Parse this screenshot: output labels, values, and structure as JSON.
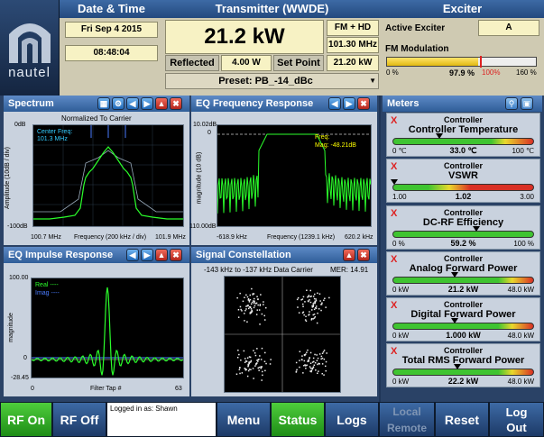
{
  "brand": "nautel",
  "date_time": {
    "title": "Date & Time",
    "date": "Fri Sep 4 2015",
    "time": "08:48:04"
  },
  "transmitter": {
    "title": "Transmitter (WWDE)",
    "power": "21.2 kW",
    "mode": "FM + HD",
    "frequency": "101.30 MHz",
    "reflected_label": "Reflected",
    "reflected_value": "4.00 W",
    "setpoint_label": "Set Point",
    "setpoint_value": "21.20 kW",
    "preset": "Preset: PB_-14_dBc"
  },
  "exciter": {
    "title": "Exciter",
    "active_label": "Active Exciter",
    "active_value": "A",
    "mod_label": "FM Modulation",
    "mod_fraction": 0.979,
    "mod_lo": "0 %",
    "mod_value": "97.9 %",
    "mod_mark": "100%",
    "mod_hi": "160 %"
  },
  "spectrum": {
    "title": "Spectrum",
    "subtitle": "Normalized To Carrier",
    "center": "Center Freq:",
    "center_value": "101.3 MHz",
    "y_top": "0dB",
    "y_bottom": "-100dB",
    "ylabel": "Amplitude (10dB / div)",
    "x_left": "100.7 MHz",
    "x_mid": "Frequency (200 kHz / div)",
    "x_right": "101.9 MHz"
  },
  "eq_freq": {
    "title": "EQ Frequency Response",
    "y_top": "10.02dB",
    "y_zero": "0",
    "y_bottom": "110.00dB",
    "ylabel": "magnitude (10 dB)",
    "freq_label": "Freq:",
    "mag_label": "Mag: -48.21dB",
    "x_left": "-618.9 kHz",
    "x_mid": "Frequency (1239.1 kHz)",
    "x_right": "620.2 kHz"
  },
  "eq_impulse": {
    "title": "EQ Impulse Response",
    "y_top": "100.00",
    "y_zero": "0",
    "y_bottom": "-28.45",
    "ylabel": "magnitude",
    "legend_real": "Real ----",
    "legend_imag": "Imag ----",
    "x_left": "0",
    "x_mid": "Filter Tap #",
    "x_right": "63"
  },
  "constellation": {
    "title": "Signal Constellation",
    "subtitle": "-143 kHz to -137 kHz Data Carrier",
    "mer": "MER: 14.91"
  },
  "meters": {
    "title": "Meters",
    "items": [
      {
        "l1": "Controller",
        "l2": "Controller Temperature",
        "lo": "0 ℃",
        "val": "33.0 ℃",
        "hi": "100 ℃",
        "fraction": 0.33
      },
      {
        "l1": "Controller",
        "l2": "VSWR",
        "lo": "1.00",
        "val": "1.02",
        "hi": "3.00",
        "fraction": 0.01
      },
      {
        "l1": "Controller",
        "l2": "DC-RF Efficiency",
        "lo": "0 %",
        "val": "59.2 %",
        "hi": "100 %",
        "fraction": 0.592
      },
      {
        "l1": "Controller",
        "l2": "Analog Forward Power",
        "lo": "0 kW",
        "val": "21.2 kW",
        "hi": "48.0 kW",
        "fraction": 0.44
      },
      {
        "l1": "Controller",
        "l2": "Digital Forward Power",
        "lo": "0 kW",
        "val": "1.000 kW",
        "hi": "48.0 kW",
        "fraction": 0.44
      },
      {
        "l1": "Controller",
        "l2": "Total RMS Forward Power",
        "lo": "0 kW",
        "val": "22.2 kW",
        "hi": "48.0 kW",
        "fraction": 0.46
      }
    ]
  },
  "bottom": {
    "rf_on": "RF On",
    "rf_off": "RF Off",
    "logged_in": "Logged in as: Shawn",
    "menu": "Menu",
    "status": "Status",
    "logs": "Logs",
    "local": "Local",
    "remote": "Remote",
    "reset": "Reset",
    "logout1": "Log",
    "logout2": "Out"
  },
  "colors": {
    "trace": "#2bff2b",
    "imag": "#4a7cff",
    "accent": "#2f5d98",
    "alarm": "#d22222"
  }
}
